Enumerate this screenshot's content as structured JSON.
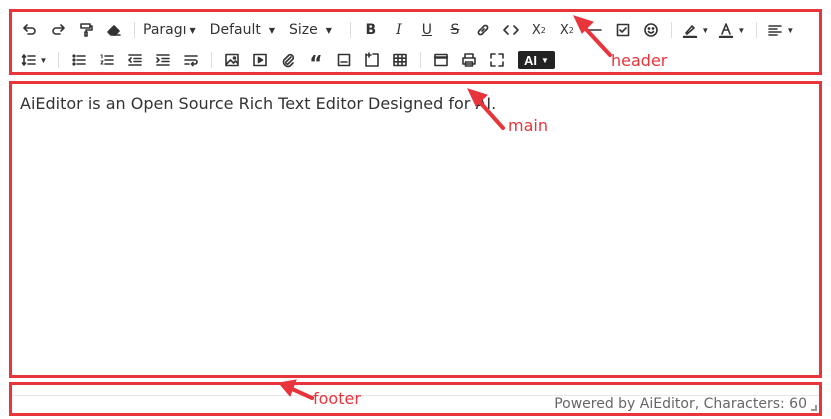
{
  "toolbar": {
    "paragraph_label": "Paragı",
    "font_family_label": "Default",
    "font_size_label": "Size",
    "ai_label": "AI"
  },
  "editor": {
    "content": "AiEditor is an Open Source Rich Text Editor Designed for AI."
  },
  "footer": {
    "status": "Powered by AiEditor, Characters: 60"
  },
  "annotations": {
    "header": "header",
    "main": "main",
    "footer": "footer"
  },
  "colors": {
    "annotation_red": "#e8343b",
    "ai_button_bg": "#222222"
  }
}
